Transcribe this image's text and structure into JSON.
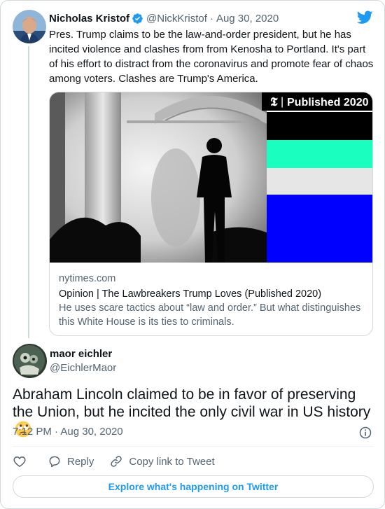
{
  "parent_tweet": {
    "author_name": "Nicholas Kristof",
    "handle": "@NickKristof",
    "date": "Aug 30, 2020",
    "text": "Pres. Trump claims to be the law-and-order president, but he has incited violence and clashes from from Kenosha to Portland. It's part of his effort to distract from the coronavirus and promote fear of chaos among voters. Clashes are Trump's America.",
    "link_card": {
      "image_badge": "Published 2020",
      "badge_logo": "𝕿",
      "domain": "nytimes.com",
      "title": "Opinion | The Lawbreakers Trump Loves (Published 2020)",
      "description": "He uses scare tactics about “law and order.” But what distinguishes this White House is its ties to criminals."
    }
  },
  "reply_tweet": {
    "author_name": "maor eichler",
    "handle": "@EichlerMaor",
    "text": "Abraham Lincoln claimed to be in favor of preserving the Union, but he incited the only civil war in US history",
    "emoji_icon": "face-with-rolling-eyes-icon",
    "time": "7:12 PM",
    "date": "Aug 30, 2020"
  },
  "actions": {
    "like_icon": "heart-icon",
    "reply_label": "Reply",
    "copy_link_label": "Copy link to Tweet"
  },
  "explore_label": "Explore what's happening on Twitter",
  "colors": {
    "twitter_blue": "#1d9bf0",
    "verified_blue": "#1d9bf0",
    "secondary_text": "#536471",
    "border": "#cfd9de"
  }
}
